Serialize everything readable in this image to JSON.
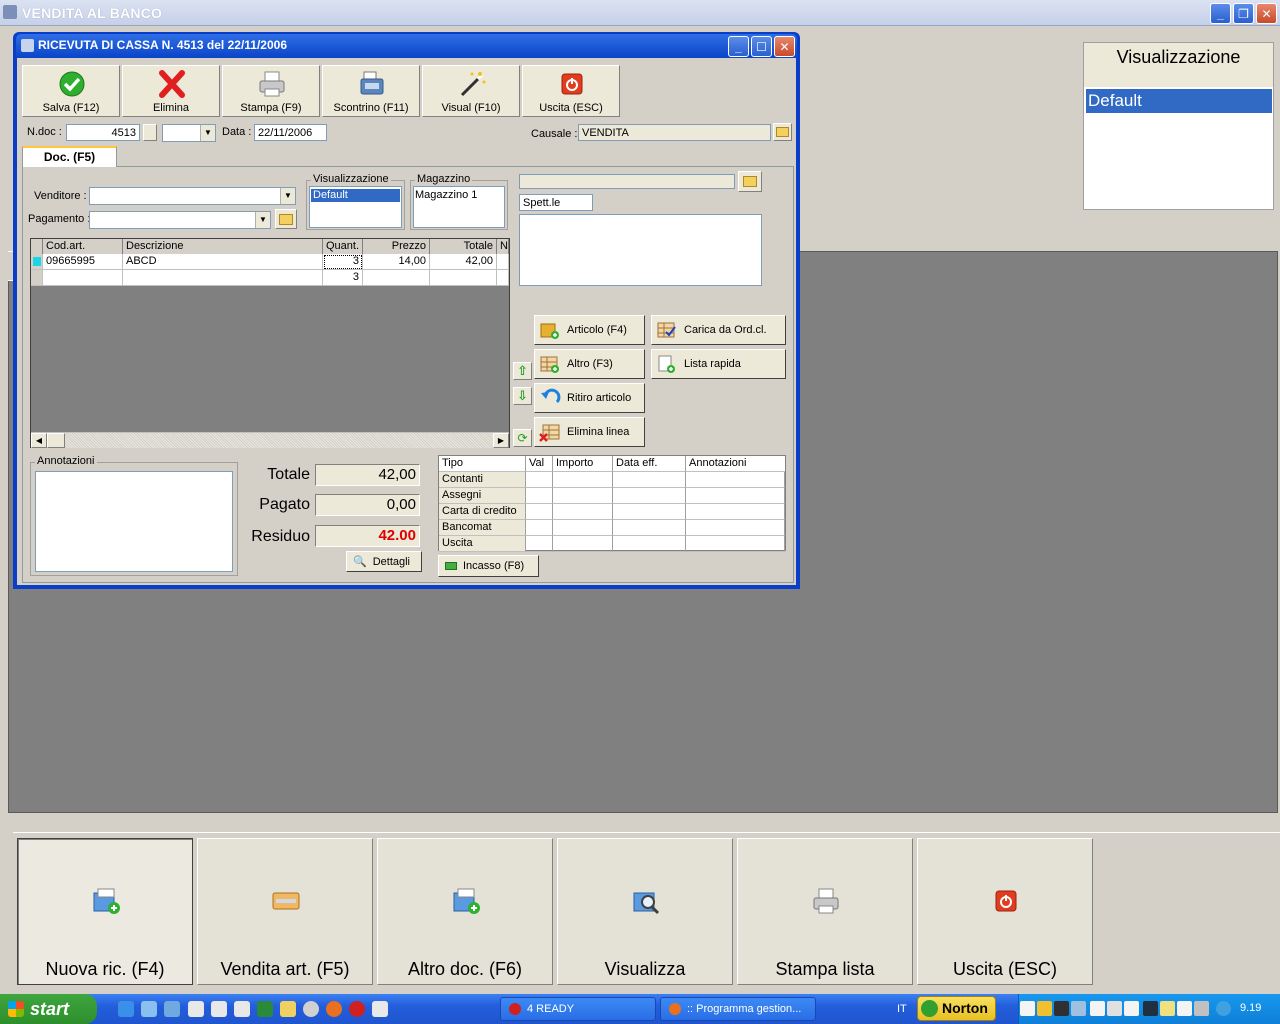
{
  "app": {
    "title": "VENDITA AL BANCO"
  },
  "viz_panel": {
    "title": "Visualizzazione",
    "selected": "Default"
  },
  "dialog": {
    "title": "RICEVUTA DI CASSA N. 4513  del 22/11/2006",
    "toolbar": [
      {
        "label": "Salva (F12)",
        "icon": "check-icon"
      },
      {
        "label": "Elimina",
        "icon": "red-x-icon"
      },
      {
        "label": "Stampa (F9)",
        "icon": "printer-icon"
      },
      {
        "label": "Scontrino (F11)",
        "icon": "cash-register-icon"
      },
      {
        "label": "Visual (F10)",
        "icon": "magic-wand-icon"
      },
      {
        "label": "Uscita (ESC)",
        "icon": "power-icon"
      }
    ],
    "ndoc_label": "N.doc :",
    "ndoc_value": "4513",
    "data_label": "Data :",
    "data_value": "22/11/2006",
    "causale_label": "Causale :",
    "causale_value": "VENDITA",
    "tab_label": "Doc. (F5)",
    "venditore_label": "Venditore :",
    "pagamento_label": "Pagamento :",
    "visualizzazione_group": "Visualizzazione",
    "visualizzazione_selected": "Default",
    "magazzino_group": "Magazzino",
    "magazzino_value": "Magazzino 1",
    "customer_prefix": "Spett.le",
    "grid": {
      "headers": [
        "Cod.art.",
        "Descrizione",
        "Quant.",
        "Prezzo",
        "Totale",
        "N"
      ],
      "rows": [
        {
          "cod": "09665995",
          "descr": "ABCD",
          "qty": "3",
          "price": "14,00",
          "total": "42,00"
        },
        {
          "cod": "",
          "descr": "",
          "qty": "3",
          "price": "",
          "total": ""
        }
      ]
    },
    "actions": {
      "articolo": "Articolo (F4)",
      "carica": "Carica da Ord.cl.",
      "altro": "Altro (F3)",
      "lista": "Lista rapida",
      "ritiro": "Ritiro articolo",
      "elimina_linea": "Elimina linea"
    },
    "annotazioni_label": "Annotazioni",
    "totals": {
      "totale_label": "Totale",
      "totale": "42,00",
      "pagato_label": "Pagato",
      "pagato": "0,00",
      "residuo_label": "Residuo",
      "residuo": "42.00",
      "residuo_color": "#e00000"
    },
    "dettagli_label": "Dettagli",
    "payments": {
      "headers": [
        "Tipo",
        "Val",
        "Importo",
        "Data eff.",
        "Annotazioni"
      ],
      "types": [
        "Contanti",
        "Assegni",
        "Carta di credito",
        "Bancomat",
        "Uscita"
      ]
    },
    "incasso_label": "Incasso (F8)"
  },
  "bottom_buttons": [
    {
      "label": "Nuova ric. (F4)",
      "icon": "new-doc-icon"
    },
    {
      "label": "Vendita art. (F5)",
      "icon": "sale-icon"
    },
    {
      "label": "Altro doc. (F6)",
      "icon": "other-doc-icon"
    },
    {
      "label": "Visualizza",
      "icon": "view-icon"
    },
    {
      "label": "Stampa lista",
      "icon": "printer-icon"
    },
    {
      "label": "Uscita (ESC)",
      "icon": "power-icon"
    }
  ],
  "taskbar": {
    "start": "start",
    "items": [
      "4 READY",
      ":: Programma gestion..."
    ],
    "lang": "IT",
    "norton": "Norton",
    "clock": "9.19"
  }
}
